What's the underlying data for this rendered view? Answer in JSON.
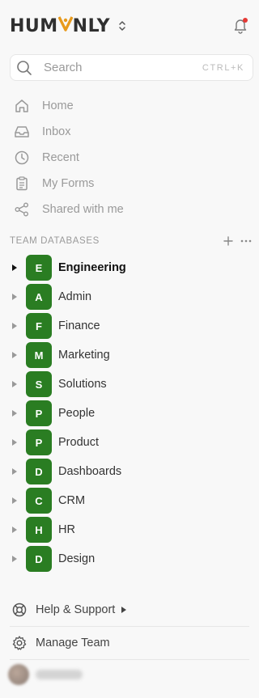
{
  "brand": {
    "pre": "HUM",
    "mark": "A",
    "post": "NLY"
  },
  "search": {
    "placeholder": "Search",
    "shortcut": "CTRL+K"
  },
  "nav": [
    {
      "label": "Home",
      "icon": "home-icon"
    },
    {
      "label": "Inbox",
      "icon": "inbox-icon"
    },
    {
      "label": "Recent",
      "icon": "clock-icon"
    },
    {
      "label": "My Forms",
      "icon": "clipboard-icon"
    },
    {
      "label": "Shared with me",
      "icon": "share-icon"
    }
  ],
  "databases": {
    "title": "TEAM DATABASES",
    "color": "#2a7d22",
    "items": [
      {
        "initial": "E",
        "name": "Engineering"
      },
      {
        "initial": "A",
        "name": "Admin"
      },
      {
        "initial": "F",
        "name": "Finance"
      },
      {
        "initial": "M",
        "name": "Marketing"
      },
      {
        "initial": "S",
        "name": "Solutions"
      },
      {
        "initial": "P",
        "name": "People"
      },
      {
        "initial": "P",
        "name": "Product"
      },
      {
        "initial": "D",
        "name": "Dashboards"
      },
      {
        "initial": "C",
        "name": "CRM"
      },
      {
        "initial": "H",
        "name": "HR"
      },
      {
        "initial": "D",
        "name": "Design"
      }
    ]
  },
  "footer": {
    "help": "Help & Support",
    "manage": "Manage Team"
  }
}
